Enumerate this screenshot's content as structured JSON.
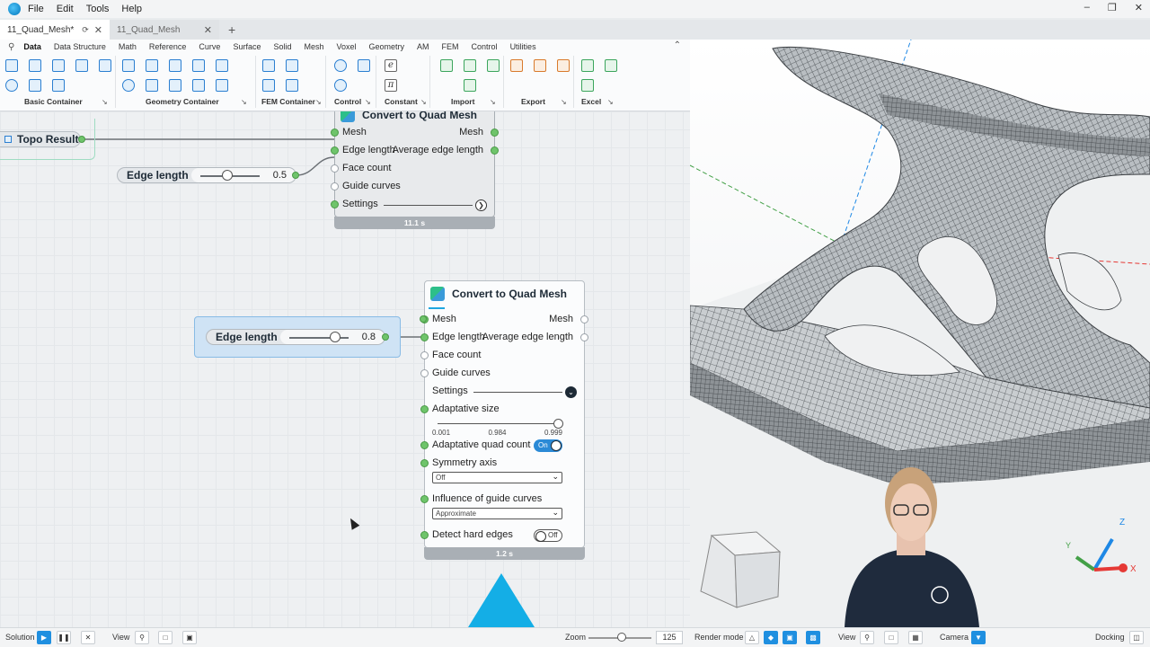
{
  "menubar": {
    "items": [
      "File",
      "Edit",
      "Tools",
      "Help"
    ]
  },
  "tabs": [
    {
      "label": "11_Quad_Mesh*",
      "active": true
    },
    {
      "label": "11_Quad_Mesh",
      "active": false
    }
  ],
  "ribbon": {
    "tabs": [
      "Data",
      "Data Structure",
      "Math",
      "Reference",
      "Curve",
      "Surface",
      "Solid",
      "Mesh",
      "Voxel",
      "Geometry",
      "AM",
      "FEM",
      "Control",
      "Utilities"
    ],
    "active_tab": "Data",
    "groups": [
      "Basic Container",
      "Geometry Container",
      "FEM Container",
      "Control",
      "Constant",
      "Import",
      "Export",
      "Excel"
    ],
    "constant_symbols": [
      "e",
      "π"
    ]
  },
  "canvas": {
    "topo_result": {
      "label": "Topo Result"
    },
    "slider1": {
      "label": "Edge length",
      "value": "0.5",
      "fraction": 0.45
    },
    "slider2": {
      "label": "Edge length",
      "value": "0.8",
      "fraction": 0.78
    },
    "node1": {
      "title": "Convert to Quad Mesh",
      "inputs": [
        "Mesh",
        "Edge length",
        "Face count",
        "Guide curves",
        "Settings"
      ],
      "outputs": [
        "Mesh",
        "Average edge length"
      ],
      "time": "11.1 s"
    },
    "node2": {
      "title": "Convert to Quad Mesh",
      "inputs": [
        "Mesh",
        "Edge length",
        "Face count",
        "Guide curves",
        "Settings"
      ],
      "outputs": [
        "Mesh",
        "Average edge length"
      ],
      "adaptive_size_label": "Adaptative size",
      "adaptive_size_ticks": [
        "0.001",
        "0.984",
        "0.999"
      ],
      "adaptive_quad_label": "Adaptative quad count",
      "adaptive_quad_toggle": "On",
      "symmetry_label": "Symmetry axis",
      "symmetry_value": "Off",
      "guide_influence_label": "Influence of guide curves",
      "guide_influence_value": "Approximate",
      "hard_edges_label": "Detect hard edges",
      "hard_edges_toggle": "Off",
      "time": "1.2 s"
    }
  },
  "viewport": {
    "axis_labels": {
      "x": "X",
      "y": "Y",
      "z": "Z"
    },
    "colors": {
      "mesh": "#5a5f63",
      "x_axis": "#e53935",
      "y_axis": "#43a047",
      "z_axis": "#1e88e5"
    }
  },
  "statusbar": {
    "solution_label": "Solution",
    "view_label": "View",
    "zoom_label": "Zoom",
    "zoom_value": "125",
    "render_mode_label": "Render mode",
    "view2_label": "View",
    "camera_label": "Camera",
    "docking_label": "Docking"
  }
}
